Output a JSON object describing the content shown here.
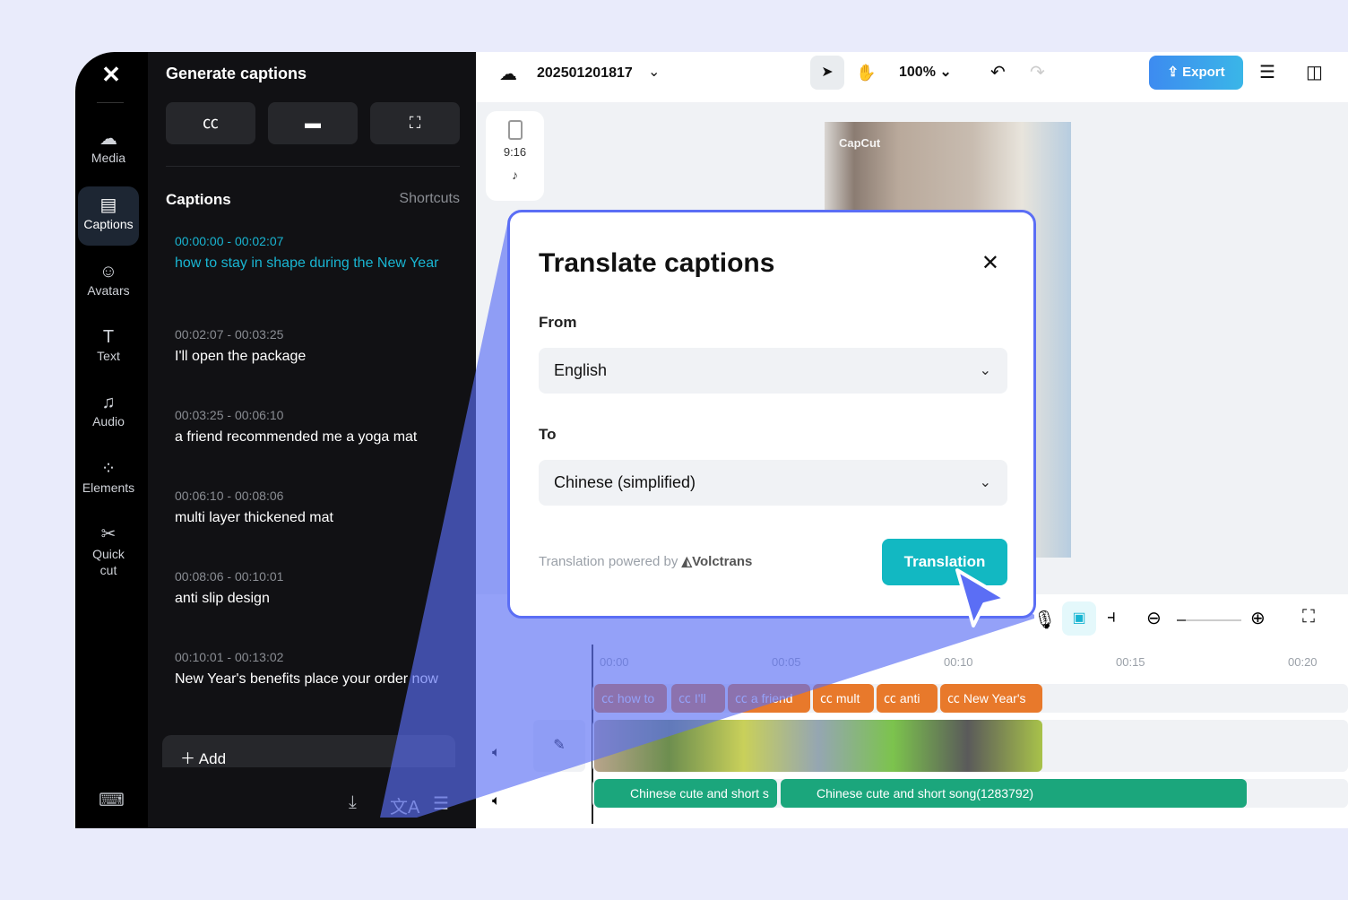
{
  "rail": {
    "items": [
      {
        "label": "Media",
        "icon": "cloud-upload-icon"
      },
      {
        "label": "Captions",
        "icon": "captions-icon",
        "active": true
      },
      {
        "label": "Avatars",
        "icon": "avatar-icon"
      },
      {
        "label": "Text",
        "icon": "text-icon"
      },
      {
        "label": "Audio",
        "icon": "music-icon"
      },
      {
        "label": "Elements",
        "icon": "elements-icon"
      },
      {
        "label": "Quick cut",
        "icon": "quick-cut-icon"
      }
    ]
  },
  "panel": {
    "title": "Generate captions",
    "captions_heading": "Captions",
    "shortcuts": "Shortcuts",
    "add_label": "Add",
    "captions": [
      {
        "time": "00:00:00 - 00:02:07",
        "text": "how to stay in shape during the New Year"
      },
      {
        "time": "00:02:07 - 00:03:25",
        "text": "I'll open the package"
      },
      {
        "time": "00:03:25 - 00:06:10",
        "text": "a friend recommended me a yoga mat"
      },
      {
        "time": "00:06:10 - 00:08:06",
        "text": "multi layer thickened mat"
      },
      {
        "time": "00:08:06 - 00:10:01",
        "text": "anti slip design"
      },
      {
        "time": "00:10:01 - 00:13:02",
        "text": "New Year's benefits place your order now"
      }
    ]
  },
  "topbar": {
    "project": "202501201817",
    "zoom": "100%",
    "export": "Export"
  },
  "ratio": {
    "label": "9:16"
  },
  "video": {
    "watermark": "CapCut"
  },
  "timeline": {
    "ticks": [
      "00:00",
      "00:05",
      "00:10",
      "00:15",
      "00:20"
    ],
    "caption_clips": [
      "how to",
      "I'll",
      "a friend",
      "mult",
      "anti",
      "New Year's"
    ],
    "audio_clips": [
      "Chinese cute and short s",
      "Chinese cute and short song(1283792)"
    ]
  },
  "modal": {
    "title": "Translate captions",
    "from_label": "From",
    "from_value": "English",
    "to_label": "To",
    "to_value": "Chinese (simplified)",
    "powered": "Translation powered by",
    "brand": "Volctrans",
    "button": "Translation"
  },
  "colors": {
    "accent": "#19b5d2",
    "modal_border": "#5b6ef5",
    "caption_clip": "#e8792b",
    "audio_clip": "#1ba67c",
    "translate_button": "#12b8c2"
  }
}
